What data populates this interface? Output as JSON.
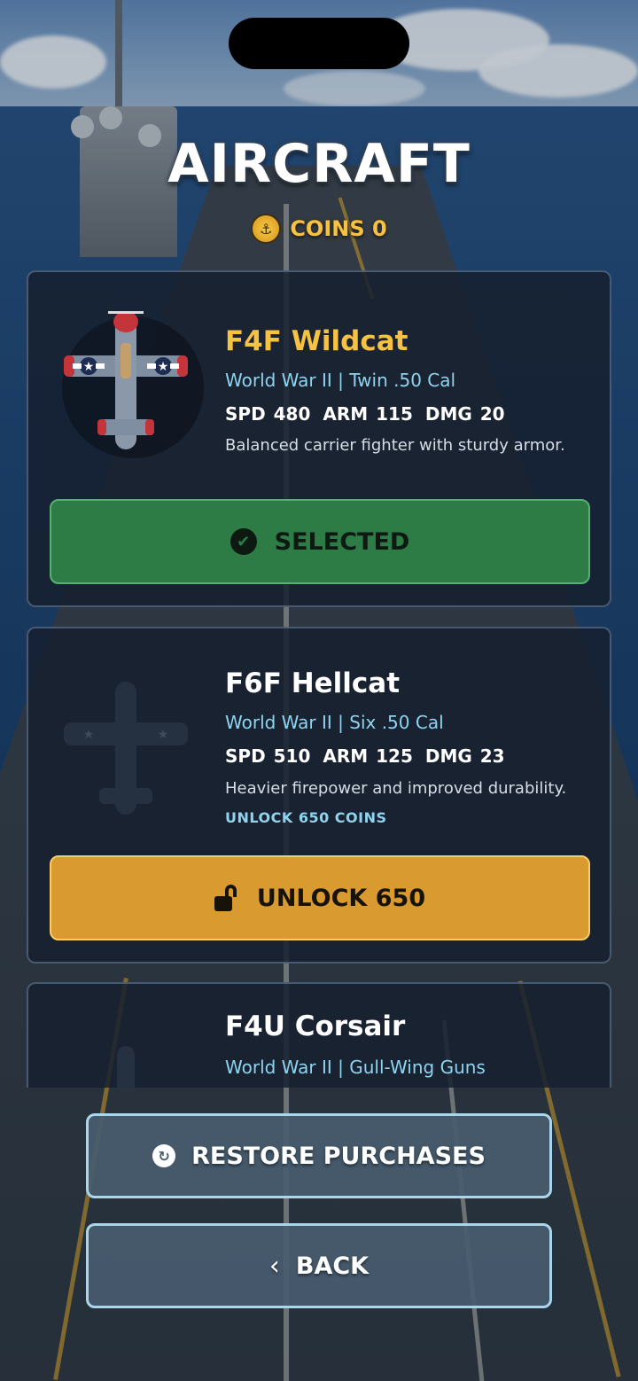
{
  "header": {
    "title": "AIRCRAFT",
    "coins_label": "COINS 0"
  },
  "aircraft": [
    {
      "name": "F4F Wildcat",
      "name_color": "#f6c244",
      "subtitle": "World War II | Twin .50 Cal",
      "spd": "SPD 480",
      "arm": "ARM 115",
      "dmg": "DMG 20",
      "description": "Balanced carrier fighter with sturdy armor.",
      "button_label": "SELECTED",
      "state": "selected"
    },
    {
      "name": "F6F Hellcat",
      "name_color": "#ffffff",
      "subtitle": "World War II | Six .50 Cal",
      "spd": "SPD 510",
      "arm": "ARM 125",
      "dmg": "DMG 23",
      "description": "Heavier firepower and improved durability.",
      "unlock_note": "UNLOCK 650 COINS",
      "button_label": "UNLOCK 650",
      "state": "locked"
    },
    {
      "name": "F4U Corsair",
      "name_color": "#ffffff",
      "subtitle": "World War II | Gull-Wing Guns",
      "state": "locked"
    }
  ],
  "footer": {
    "restore_label": "RESTORE PURCHASES",
    "back_label": "BACK"
  },
  "icons": {
    "coin": "anchor-coin-icon",
    "selected": "check-badge-icon",
    "unlock": "unlock-icon",
    "restore": "restore-icon",
    "back": "chevron-left-icon"
  },
  "colors": {
    "accent_gold": "#f6c244",
    "accent_cyan": "#8fd4ef",
    "selected_green": "#2d7b45",
    "unlock_orange": "#d99a30"
  }
}
